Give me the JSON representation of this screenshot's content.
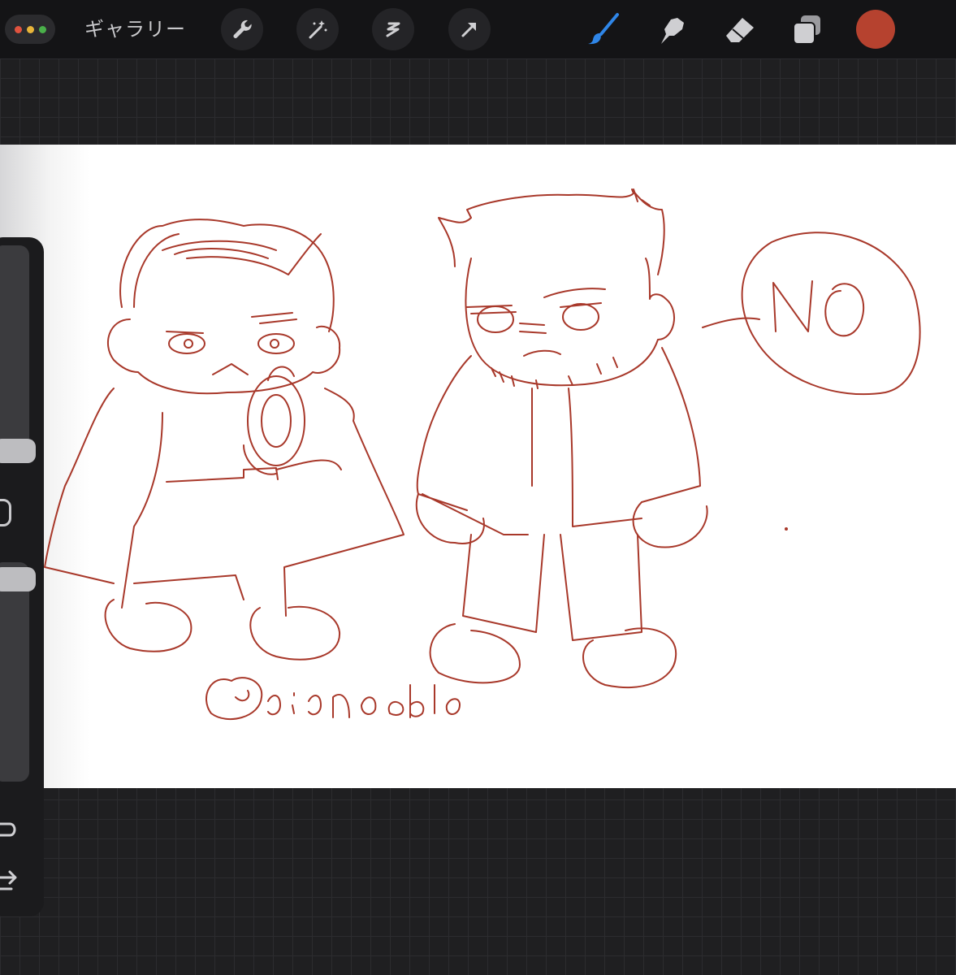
{
  "toolbar": {
    "gallery_label": "ギャラリー",
    "window_dots": [
      "#e0533f",
      "#e8b53a",
      "#4ab04a"
    ],
    "left_tools": [
      "wrench-icon",
      "magic-wand-icon",
      "selection-icon",
      "transform-arrow-icon"
    ],
    "right_tools": [
      "brush-icon",
      "smudge-icon",
      "eraser-icon",
      "layers-icon"
    ],
    "active_tool": "brush-icon",
    "active_color": "#b6422f"
  },
  "sidebar": {
    "controls": [
      "brush-size-slider",
      "modify-button",
      "opacity-slider",
      "undo-icon",
      "redo-icon"
    ]
  },
  "canvas": {
    "speech_bubble_text": "NO",
    "signature": "@eienable"
  }
}
